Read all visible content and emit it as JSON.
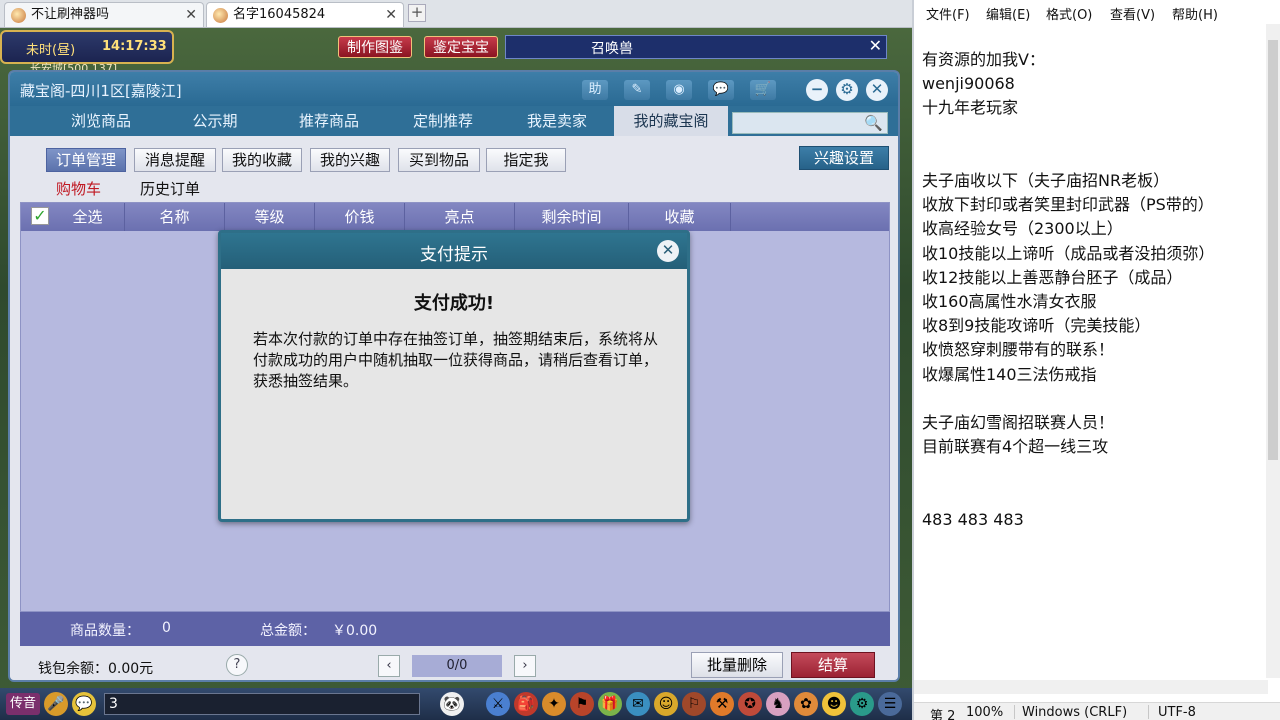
{
  "browser": {
    "tabs": [
      {
        "label": "不让刷神器吗",
        "close": "✕"
      },
      {
        "label": "名字16045824",
        "close": "✕"
      }
    ],
    "new_tab": "+"
  },
  "game": {
    "time_period": "未时(昼)",
    "time_clock": "14:17:33",
    "location": "长安城[500,137]",
    "top_buttons": [
      "制作图鉴",
      "鉴定宝宝"
    ],
    "summon_title": "召唤兽",
    "summon_close": "✕",
    "window": {
      "title": "藏宝阁-四川1区[嘉陵江]",
      "title_icons": [
        "助",
        "✎",
        "◉",
        "💬",
        "🛒"
      ],
      "control_icons": [
        "−",
        "⚙",
        "✕"
      ],
      "tabs": [
        "浏览商品",
        "公示期",
        "推荐商品",
        "定制推荐",
        "我是卖家",
        "我的藏宝阁"
      ],
      "active_tab": 5,
      "search_placeholder": "",
      "search_icon": "🔍",
      "sub_buttons": [
        "订单管理",
        "消息提醒",
        "我的收藏",
        "我的兴趣",
        "买到物品",
        "指定我"
      ],
      "interest_button": "兴趣设置",
      "subtabs": [
        "购物车",
        "历史订单"
      ],
      "table_headers": [
        "全选",
        "名称",
        "等级",
        "价钱",
        "亮点",
        "剩余时间",
        "收藏"
      ],
      "checkbox_mark": "✓",
      "footer": {
        "item_count_label": "商品数量：",
        "item_count": "0",
        "total_label": "总金额：",
        "total_value": "￥0.00"
      },
      "wallet": "钱包余额：0.00元",
      "help": "?",
      "prev": "‹",
      "page": "0/0",
      "next": "›",
      "bulk_delete": "批量删除",
      "checkout": "结算"
    },
    "dialog": {
      "title": "支付提示",
      "close": "✕",
      "heading": "支付成功!",
      "message": "若本次付款的订单中存在抽签订单，抽签期结束后，系统将从付款成功的用户中随机抽取一位获得商品，请稍后查看订单，获悉抽签结果。"
    },
    "bottom_bar": {
      "voice": "传音",
      "chat_value": "3"
    }
  },
  "notepad": {
    "menu": [
      "文件(F)",
      "编辑(E)",
      "格式(O)",
      "查看(V)",
      "帮助(H)"
    ],
    "lines": [
      "有资源的加我V：",
      "wenji90068",
      "十九年老玩家",
      "",
      "",
      "夫子庙收以下（夫子庙招NR老板）",
      "收放下封印或者笑里封印武器（PS带的）",
      "收高经验女号（2300以上）",
      "收10技能以上谛听（成品或者没拍须弥）",
      "收12技能以上善恶静台胚子（成品）",
      "收160高属性水清女衣服",
      "收8到9技能攻谛听（完美技能）",
      "收愤怒穿刺腰带有的联系！",
      "收爆属性140三法伤戒指",
      "",
      "夫子庙幻雪阁招联赛人员！",
      "目前联赛有4个超一线三攻",
      "",
      "",
      "483 483 483"
    ],
    "status": {
      "position": "第 2",
      "zoom": "100%",
      "line_ending": "Windows (CRLF)",
      "encoding": "UTF-8"
    }
  }
}
